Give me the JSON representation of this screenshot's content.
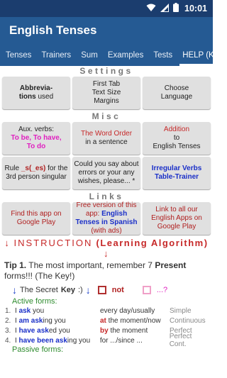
{
  "status": {
    "time": "10:01"
  },
  "app": {
    "title": "English Tenses"
  },
  "tabs": [
    "Tenses",
    "Trainers",
    "Sum",
    "Examples",
    "Tests",
    "HELP (Key)"
  ],
  "sections": {
    "settings": "Settings",
    "misc": "Misc",
    "links": "Links"
  },
  "settings": {
    "abbrev_1": "Abbrevia-",
    "abbrev_2": "tions",
    "abbrev_3": " used",
    "firsttab_1": "First Tab",
    "firsttab_2": "Text Size",
    "firsttab_3": "Margins",
    "lang_1": "Choose",
    "lang_2": "Language"
  },
  "misc": {
    "aux_1": "Aux. verbs:",
    "aux_2": "To be, To have,",
    "aux_3": "To do",
    "order_1": "The Word Order",
    "order_2": "in a sentence",
    "add_1": "Addition",
    "add_2": "to",
    "add_3": "English Tenses",
    "rule_1": "Rule ",
    "rule_2": "_s(_es)",
    "rule_3": " for the 3rd person singular",
    "errors": "Could you say about errors or your any wishes, please... *",
    "irreg_1": "Irregular Verbs",
    "irreg_2": "Table-Trainer"
  },
  "links": {
    "find_1": "Find this app on",
    "find_2": "Google Play",
    "free_1": "Free version of this app: ",
    "free_2": "English Tenses in Spanish",
    "free_3": " (with ads)",
    "all_1": "Link to all our English Apps on Google Play"
  },
  "instruction": {
    "arrow": "↓",
    "title": "INSTRUCTION",
    "sub": " (Learning Algorithm) "
  },
  "tip": {
    "label": "Tip 1.",
    "text_1": " The most important, remember 7 ",
    "text_2": "Present",
    "text_3": " forms!!! (The Key!)"
  },
  "key": {
    "text_1": "The Secret ",
    "text_2": "Key",
    "text_3": " :) ",
    "not": "not",
    "q": "...?"
  },
  "active_forms": "Active forms:",
  "passive_forms": "Passive forms:",
  "rows": [
    {
      "n": "1.",
      "pre": "I ",
      "verb": "ask",
      "post": " you",
      "time_hl": "",
      "time": "every day/usually",
      "tense": "Simple"
    },
    {
      "n": "2.",
      "pre": "I ",
      "verb": "am ask",
      "verb2": "ing",
      "post": " you",
      "time_hl": "at",
      "time": " the moment/now",
      "tense": "Continuous"
    },
    {
      "n": "3.",
      "pre": "I ",
      "verb": "have ask",
      "verb2": "ed",
      "post": " you",
      "time_hl": "by",
      "time": " the moment",
      "tense": "Perfect"
    },
    {
      "n": "4.",
      "pre": "I ",
      "verb": "have been ask",
      "verb2": "ing",
      "post": " you",
      "time_hl": "",
      "time": "for .../since ...",
      "tense": "Perfect Cont."
    }
  ],
  "colors": {
    "status_bar": "#1b3d6e",
    "app_bar": "#255a93",
    "accent_red": "#c62828",
    "accent_magenta": "#e020c0",
    "accent_blue": "#1a2fc8",
    "card_bg": "#e0e0e0"
  }
}
